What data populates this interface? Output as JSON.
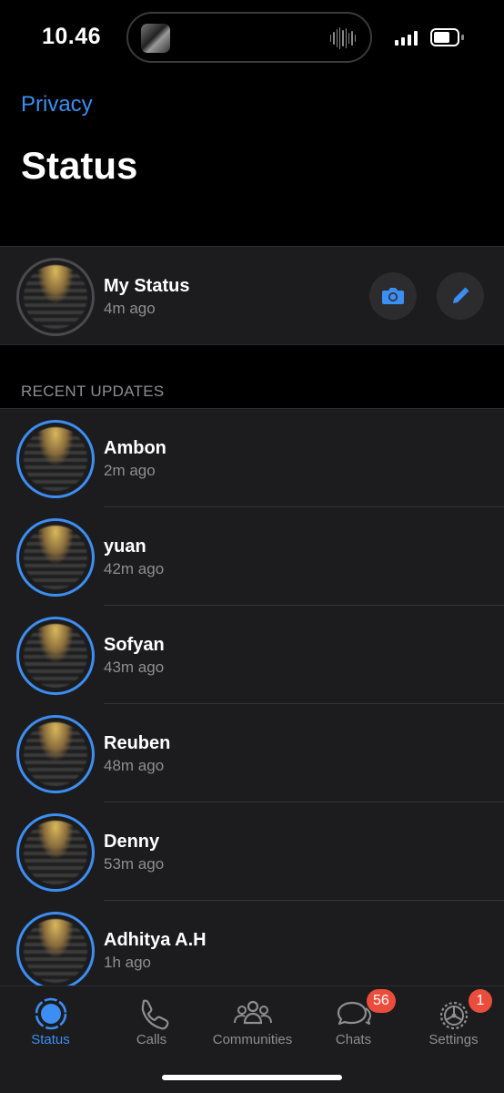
{
  "status_bar": {
    "time": "10.46",
    "signal_icon": "cellular-signal-icon",
    "battery_icon": "battery-icon",
    "battery_level": 0.72
  },
  "header": {
    "back_label": "Privacy",
    "title": "Status"
  },
  "my_status": {
    "name": "My Status",
    "time": "4m ago",
    "camera_icon": "camera-icon",
    "pencil_icon": "pencil-icon"
  },
  "recent_updates": {
    "section_label": "RECENT UPDATES",
    "items": [
      {
        "name": "Ambon",
        "time": "2m ago"
      },
      {
        "name": "yuan",
        "time": "42m ago"
      },
      {
        "name": "Sofyan",
        "time": "43m ago"
      },
      {
        "name": "Reuben",
        "time": "48m ago"
      },
      {
        "name": "Denny",
        "time": "53m ago"
      },
      {
        "name": "Adhitya A.H",
        "time": "1h ago"
      }
    ]
  },
  "tabs": [
    {
      "label": "Status",
      "icon": "status-ring-icon",
      "active": true
    },
    {
      "label": "Calls",
      "icon": "phone-icon",
      "active": false
    },
    {
      "label": "Communities",
      "icon": "communities-icon",
      "active": false
    },
    {
      "label": "Chats",
      "icon": "chat-bubbles-icon",
      "active": false,
      "badge": "56"
    },
    {
      "label": "Settings",
      "icon": "gear-icon",
      "active": false,
      "badge": "1"
    }
  ],
  "colors": {
    "accent": "#3d8ef2",
    "badge": "#eb4d3d",
    "background": "#000000",
    "surface": "#1c1c1e",
    "secondary_text": "#8e8e93"
  }
}
